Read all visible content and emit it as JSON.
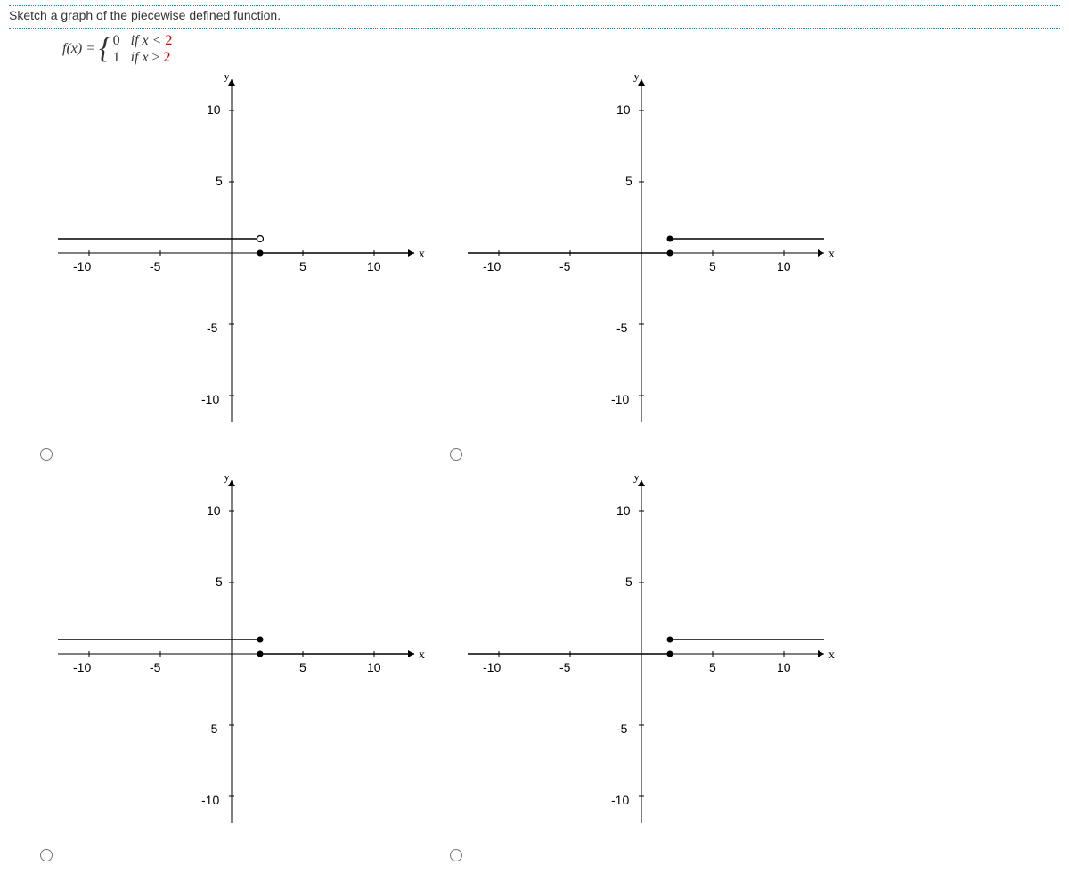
{
  "question": {
    "prompt": "Sketch a graph of the piecewise defined function.",
    "function_name": "f(x) = ",
    "case1_value": "0",
    "case1_cond_prefix": "if x < ",
    "case1_cond_num": "2",
    "case2_value": "1",
    "case2_cond_prefix": "if x ≥ ",
    "case2_cond_num": "2"
  },
  "axis": {
    "y_label": "y",
    "x_label": "x",
    "ticks_y": [
      "10",
      "5",
      "-5",
      "-10"
    ],
    "ticks_x": [
      "-10",
      "-5",
      "5",
      "10"
    ]
  },
  "chart_data": [
    {
      "type": "line",
      "title": "Option A",
      "xlim": [
        -12,
        12
      ],
      "ylim": [
        -12,
        12
      ],
      "series": [
        {
          "name": "left segment",
          "x": [
            -12,
            2
          ],
          "y": [
            1,
            1
          ],
          "endpoint_at_x2": "open"
        },
        {
          "name": "right segment",
          "x": [
            2,
            12
          ],
          "y": [
            0,
            0
          ],
          "endpoint_at_x1": "closed"
        }
      ]
    },
    {
      "type": "line",
      "title": "Option B",
      "xlim": [
        -12,
        12
      ],
      "ylim": [
        -12,
        12
      ],
      "series": [
        {
          "name": "left segment",
          "x": [
            -12,
            2
          ],
          "y": [
            0,
            0
          ],
          "endpoint_at_x2": "closed"
        },
        {
          "name": "right segment",
          "x": [
            2,
            12
          ],
          "y": [
            1,
            1
          ],
          "endpoint_at_x1": "closed"
        }
      ]
    },
    {
      "type": "line",
      "title": "Option C",
      "xlim": [
        -12,
        12
      ],
      "ylim": [
        -12,
        12
      ],
      "series": [
        {
          "name": "left segment",
          "x": [
            -12,
            2
          ],
          "y": [
            1,
            1
          ],
          "endpoint_at_x2": "closed"
        },
        {
          "name": "right segment",
          "x": [
            2,
            12
          ],
          "y": [
            0,
            0
          ],
          "endpoint_at_x1": "closed"
        }
      ]
    },
    {
      "type": "line",
      "title": "Option D",
      "xlim": [
        -12,
        12
      ],
      "ylim": [
        -12,
        12
      ],
      "series": [
        {
          "name": "left segment",
          "x": [
            -12,
            2
          ],
          "y": [
            0,
            0
          ],
          "endpoint_at_x2": "closed"
        },
        {
          "name": "right segment",
          "x": [
            2,
            12
          ],
          "y": [
            1,
            1
          ],
          "endpoint_at_x1": "closed"
        }
      ]
    }
  ]
}
